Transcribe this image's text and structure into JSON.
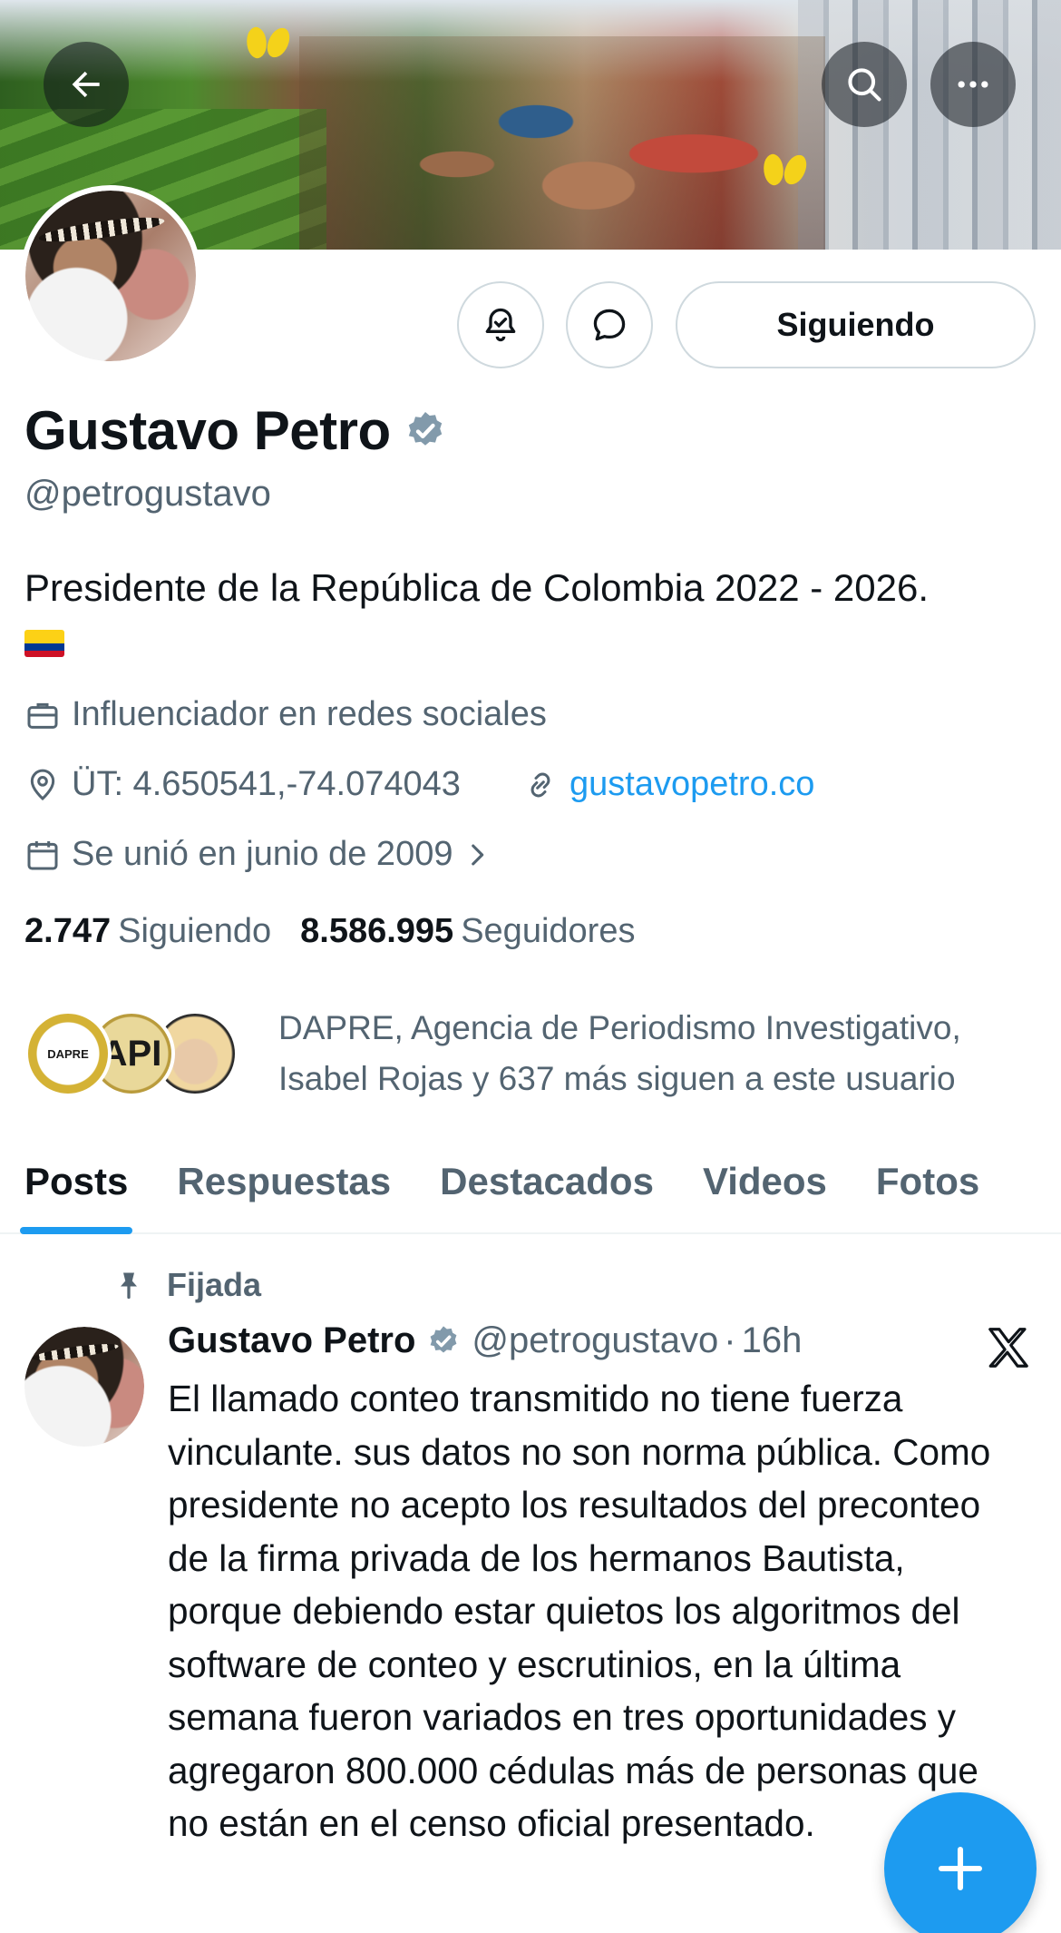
{
  "profile": {
    "name": "Gustavo Petro",
    "handle": "@petrogustavo",
    "bio": "Presidente de la República de Colombia 2022 - 2026.",
    "category": "Influenciador en redes sociales",
    "location": "ÜT: 4.650541,-74.074043",
    "website": "gustavopetro.co",
    "joined": "Se unió en junio de 2009"
  },
  "actions": {
    "follow_label": "Siguiendo"
  },
  "stats": {
    "following_count": "2.747",
    "following_label": "Siguiendo",
    "followers_count": "8.586.995",
    "followers_label": "Seguidores"
  },
  "followed_by": {
    "text": "DAPRE, Agencia de Periodismo Investigativo, Isabel Rojas y 637 más siguen a este usuario",
    "avatar_dapre_text": "DAPRE",
    "avatar_api_text": "API"
  },
  "tabs": [
    {
      "label": "Posts"
    },
    {
      "label": "Respuestas"
    },
    {
      "label": "Destacados"
    },
    {
      "label": "Videos"
    },
    {
      "label": "Fotos"
    }
  ],
  "post": {
    "pinned_label": "Fijada",
    "author": "Gustavo Petro",
    "handle": "@petrogustavo",
    "separator": "·",
    "time": "16h",
    "text": "El llamado conteo transmitido no tiene fuerza vinculante. sus datos no son norma pública. Como presidente no acepto los resultados del preconteo de la firma privada  de los hermanos Bautista, porque debiendo estar quietos los algoritmos del software de conteo y escrutinios, en la última semana fueron variados en tres oportunidades y agregaron 800.000 cédulas más de personas que no están en el censo oficial presentado."
  },
  "colors": {
    "accent": "#1d9bf0",
    "text_primary": "#0f1419",
    "text_secondary": "#536471",
    "border": "#cfd9de"
  },
  "icons": {
    "back": "arrow-left-icon",
    "search": "search-icon",
    "more": "more-dots-icon",
    "notifications": "bell-icon",
    "message": "message-bubble-icon",
    "verified": "verified-badge-icon",
    "category": "briefcase-icon",
    "location": "location-pin-icon",
    "link": "link-icon",
    "calendar": "calendar-icon",
    "chevron": "chevron-right-icon",
    "pin": "pin-icon",
    "x_logo": "x-logo-icon",
    "compose": "plus-icon"
  }
}
